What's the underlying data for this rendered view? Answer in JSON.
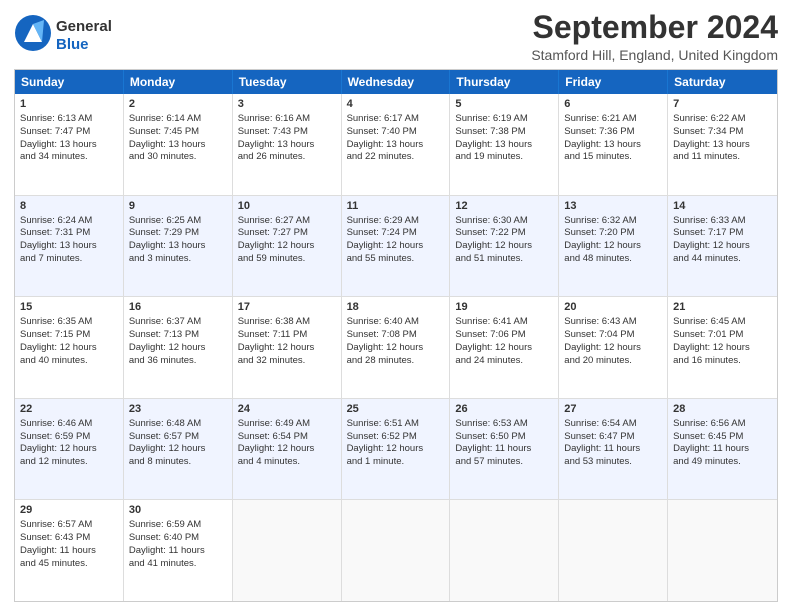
{
  "logo": {
    "general": "General",
    "blue": "Blue"
  },
  "title": "September 2024",
  "location": "Stamford Hill, England, United Kingdom",
  "headers": [
    "Sunday",
    "Monday",
    "Tuesday",
    "Wednesday",
    "Thursday",
    "Friday",
    "Saturday"
  ],
  "rows": [
    [
      {
        "day": "1",
        "lines": [
          "Sunrise: 6:13 AM",
          "Sunset: 7:47 PM",
          "Daylight: 13 hours",
          "and 34 minutes."
        ]
      },
      {
        "day": "2",
        "lines": [
          "Sunrise: 6:14 AM",
          "Sunset: 7:45 PM",
          "Daylight: 13 hours",
          "and 30 minutes."
        ]
      },
      {
        "day": "3",
        "lines": [
          "Sunrise: 6:16 AM",
          "Sunset: 7:43 PM",
          "Daylight: 13 hours",
          "and 26 minutes."
        ]
      },
      {
        "day": "4",
        "lines": [
          "Sunrise: 6:17 AM",
          "Sunset: 7:40 PM",
          "Daylight: 13 hours",
          "and 22 minutes."
        ]
      },
      {
        "day": "5",
        "lines": [
          "Sunrise: 6:19 AM",
          "Sunset: 7:38 PM",
          "Daylight: 13 hours",
          "and 19 minutes."
        ]
      },
      {
        "day": "6",
        "lines": [
          "Sunrise: 6:21 AM",
          "Sunset: 7:36 PM",
          "Daylight: 13 hours",
          "and 15 minutes."
        ]
      },
      {
        "day": "7",
        "lines": [
          "Sunrise: 6:22 AM",
          "Sunset: 7:34 PM",
          "Daylight: 13 hours",
          "and 11 minutes."
        ]
      }
    ],
    [
      {
        "day": "8",
        "lines": [
          "Sunrise: 6:24 AM",
          "Sunset: 7:31 PM",
          "Daylight: 13 hours",
          "and 7 minutes."
        ]
      },
      {
        "day": "9",
        "lines": [
          "Sunrise: 6:25 AM",
          "Sunset: 7:29 PM",
          "Daylight: 13 hours",
          "and 3 minutes."
        ]
      },
      {
        "day": "10",
        "lines": [
          "Sunrise: 6:27 AM",
          "Sunset: 7:27 PM",
          "Daylight: 12 hours",
          "and 59 minutes."
        ]
      },
      {
        "day": "11",
        "lines": [
          "Sunrise: 6:29 AM",
          "Sunset: 7:24 PM",
          "Daylight: 12 hours",
          "and 55 minutes."
        ]
      },
      {
        "day": "12",
        "lines": [
          "Sunrise: 6:30 AM",
          "Sunset: 7:22 PM",
          "Daylight: 12 hours",
          "and 51 minutes."
        ]
      },
      {
        "day": "13",
        "lines": [
          "Sunrise: 6:32 AM",
          "Sunset: 7:20 PM",
          "Daylight: 12 hours",
          "and 48 minutes."
        ]
      },
      {
        "day": "14",
        "lines": [
          "Sunrise: 6:33 AM",
          "Sunset: 7:17 PM",
          "Daylight: 12 hours",
          "and 44 minutes."
        ]
      }
    ],
    [
      {
        "day": "15",
        "lines": [
          "Sunrise: 6:35 AM",
          "Sunset: 7:15 PM",
          "Daylight: 12 hours",
          "and 40 minutes."
        ]
      },
      {
        "day": "16",
        "lines": [
          "Sunrise: 6:37 AM",
          "Sunset: 7:13 PM",
          "Daylight: 12 hours",
          "and 36 minutes."
        ]
      },
      {
        "day": "17",
        "lines": [
          "Sunrise: 6:38 AM",
          "Sunset: 7:11 PM",
          "Daylight: 12 hours",
          "and 32 minutes."
        ]
      },
      {
        "day": "18",
        "lines": [
          "Sunrise: 6:40 AM",
          "Sunset: 7:08 PM",
          "Daylight: 12 hours",
          "and 28 minutes."
        ]
      },
      {
        "day": "19",
        "lines": [
          "Sunrise: 6:41 AM",
          "Sunset: 7:06 PM",
          "Daylight: 12 hours",
          "and 24 minutes."
        ]
      },
      {
        "day": "20",
        "lines": [
          "Sunrise: 6:43 AM",
          "Sunset: 7:04 PM",
          "Daylight: 12 hours",
          "and 20 minutes."
        ]
      },
      {
        "day": "21",
        "lines": [
          "Sunrise: 6:45 AM",
          "Sunset: 7:01 PM",
          "Daylight: 12 hours",
          "and 16 minutes."
        ]
      }
    ],
    [
      {
        "day": "22",
        "lines": [
          "Sunrise: 6:46 AM",
          "Sunset: 6:59 PM",
          "Daylight: 12 hours",
          "and 12 minutes."
        ]
      },
      {
        "day": "23",
        "lines": [
          "Sunrise: 6:48 AM",
          "Sunset: 6:57 PM",
          "Daylight: 12 hours",
          "and 8 minutes."
        ]
      },
      {
        "day": "24",
        "lines": [
          "Sunrise: 6:49 AM",
          "Sunset: 6:54 PM",
          "Daylight: 12 hours",
          "and 4 minutes."
        ]
      },
      {
        "day": "25",
        "lines": [
          "Sunrise: 6:51 AM",
          "Sunset: 6:52 PM",
          "Daylight: 12 hours",
          "and 1 minute."
        ]
      },
      {
        "day": "26",
        "lines": [
          "Sunrise: 6:53 AM",
          "Sunset: 6:50 PM",
          "Daylight: 11 hours",
          "and 57 minutes."
        ]
      },
      {
        "day": "27",
        "lines": [
          "Sunrise: 6:54 AM",
          "Sunset: 6:47 PM",
          "Daylight: 11 hours",
          "and 53 minutes."
        ]
      },
      {
        "day": "28",
        "lines": [
          "Sunrise: 6:56 AM",
          "Sunset: 6:45 PM",
          "Daylight: 11 hours",
          "and 49 minutes."
        ]
      }
    ],
    [
      {
        "day": "29",
        "lines": [
          "Sunrise: 6:57 AM",
          "Sunset: 6:43 PM",
          "Daylight: 11 hours",
          "and 45 minutes."
        ]
      },
      {
        "day": "30",
        "lines": [
          "Sunrise: 6:59 AM",
          "Sunset: 6:40 PM",
          "Daylight: 11 hours",
          "and 41 minutes."
        ]
      },
      {
        "day": "",
        "lines": []
      },
      {
        "day": "",
        "lines": []
      },
      {
        "day": "",
        "lines": []
      },
      {
        "day": "",
        "lines": []
      },
      {
        "day": "",
        "lines": []
      }
    ]
  ]
}
